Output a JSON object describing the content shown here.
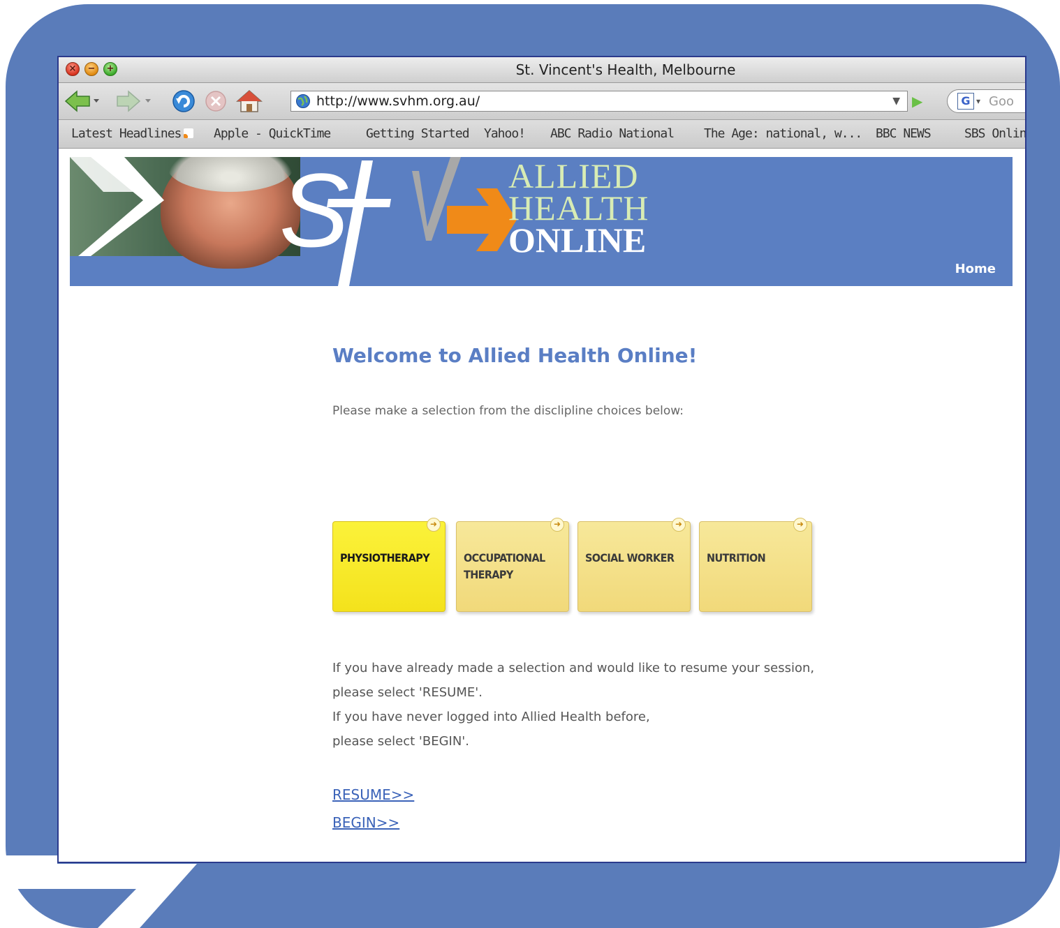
{
  "browser": {
    "window_title": "St. Vincent's Health, Melbourne",
    "url": "http://www.svhm.org.au/",
    "search_placeholder": "Goo",
    "bookmarks": [
      "Latest Headlines",
      "Apple - QuickTime",
      "Getting Started",
      "Yahoo!",
      "ABC Radio National",
      "The Age: national, w...",
      "BBC NEWS",
      "SBS Onlin"
    ]
  },
  "banner": {
    "logo_line1": "ALLIED",
    "logo_line2": "HEALTH",
    "logo_line3": "ONLINE",
    "home_link": "Home"
  },
  "main": {
    "heading": "Welcome to Allied Health Online!",
    "instruction": "Please make a selection from the disclipline choices below:",
    "disciplines": [
      {
        "label": "PHYSIOTHERAPY",
        "selected": true
      },
      {
        "label": "OCCUPATIONAL THERAPY",
        "selected": false
      },
      {
        "label": "SOCIAL WORKER",
        "selected": false
      },
      {
        "label": "NUTRITION",
        "selected": false
      }
    ],
    "info_lines": [
      "If you have already made a selection and would like to resume your session,",
      "please select 'RESUME'.",
      "If you have never logged into Allied Health before,",
      "please select 'BEGIN'."
    ],
    "resume_link": "RESUME>>",
    "begin_link": "BEGIN>>"
  },
  "colors": {
    "frame_blue": "#5a7cba",
    "banner_blue": "#5b7fc2",
    "heading_blue": "#5a7ec4",
    "tile_selected": "#f4e21c",
    "tile_default": "#f1d97a",
    "logo_orange": "#f08a18"
  }
}
